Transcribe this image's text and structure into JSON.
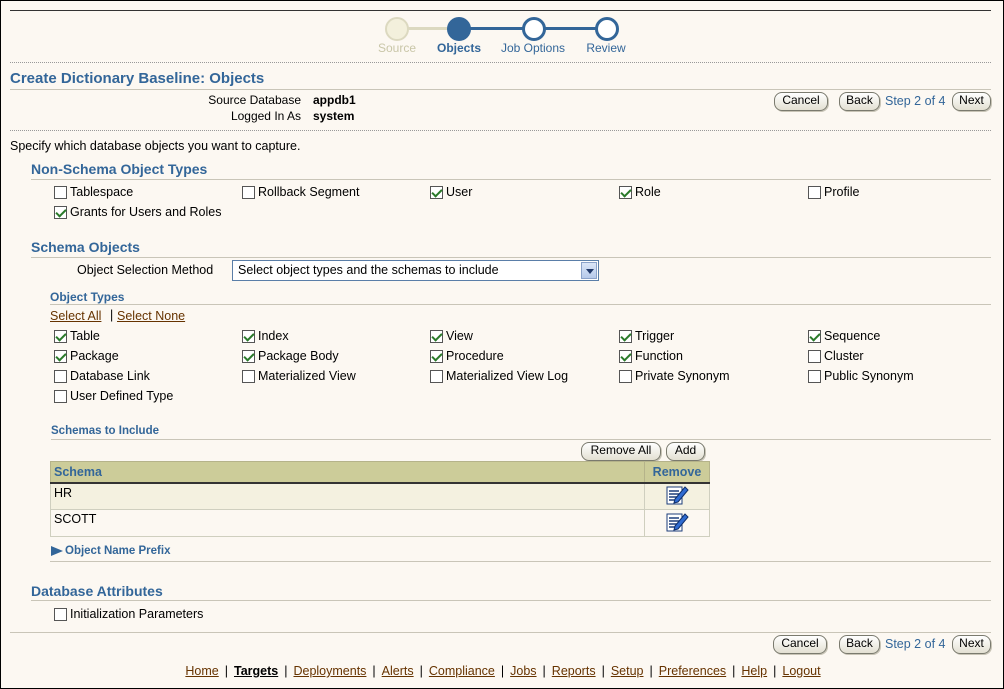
{
  "train": {
    "steps": [
      {
        "label": "Source",
        "state": "done"
      },
      {
        "label": "Objects",
        "state": "current"
      },
      {
        "label": "Job Options",
        "state": "next"
      },
      {
        "label": "Review",
        "state": "next"
      }
    ]
  },
  "header": {
    "title": "Create Dictionary Baseline: Objects",
    "source_db_label": "Source Database",
    "source_db_value": "appdb1",
    "logged_in_label": "Logged In As",
    "logged_in_value": "system"
  },
  "nav": {
    "cancel": "Cancel",
    "back": "Back",
    "step_text": "Step 2 of 4",
    "next": "Next"
  },
  "intro": "Specify which database objects you want to capture.",
  "non_schema": {
    "heading": "Non-Schema Object Types",
    "items": [
      {
        "label": "Tablespace",
        "checked": false
      },
      {
        "label": "Rollback Segment",
        "checked": false
      },
      {
        "label": "User",
        "checked": true
      },
      {
        "label": "Role",
        "checked": true
      },
      {
        "label": "Profile",
        "checked": false
      },
      {
        "label": "Grants for Users and Roles",
        "checked": true
      }
    ]
  },
  "schema_objects": {
    "heading": "Schema Objects",
    "method_label": "Object Selection Method",
    "method_value": "Select object types and the schemas to include",
    "object_types_heading": "Object Types",
    "select_all": "Select All",
    "select_sep": "|",
    "select_none": "Select None",
    "types": [
      {
        "label": "Table",
        "checked": true
      },
      {
        "label": "Index",
        "checked": true
      },
      {
        "label": "View",
        "checked": true
      },
      {
        "label": "Trigger",
        "checked": true
      },
      {
        "label": "Sequence",
        "checked": true
      },
      {
        "label": "Package",
        "checked": true
      },
      {
        "label": "Package Body",
        "checked": true
      },
      {
        "label": "Procedure",
        "checked": true
      },
      {
        "label": "Function",
        "checked": true
      },
      {
        "label": "Cluster",
        "checked": false
      },
      {
        "label": "Database Link",
        "checked": false
      },
      {
        "label": "Materialized View",
        "checked": false
      },
      {
        "label": "Materialized View Log",
        "checked": false
      },
      {
        "label": "Private Synonym",
        "checked": false
      },
      {
        "label": "Public Synonym",
        "checked": false
      },
      {
        "label": "User Defined Type",
        "checked": false
      }
    ],
    "schemas_heading": "Schemas to Include",
    "remove_all": "Remove All",
    "add": "Add",
    "columns": [
      "Schema",
      "Remove"
    ],
    "rows": [
      "HR",
      "SCOTT"
    ],
    "prefix_label": "Object Name Prefix"
  },
  "db_attributes": {
    "heading": "Database Attributes",
    "items": [
      {
        "label": "Initialization Parameters",
        "checked": false
      }
    ]
  },
  "footer": {
    "links": [
      "Home",
      "Targets",
      "Deployments",
      "Alerts",
      "Compliance",
      "Jobs",
      "Reports",
      "Setup",
      "Preferences",
      "Help",
      "Logout"
    ],
    "current": "Targets"
  }
}
